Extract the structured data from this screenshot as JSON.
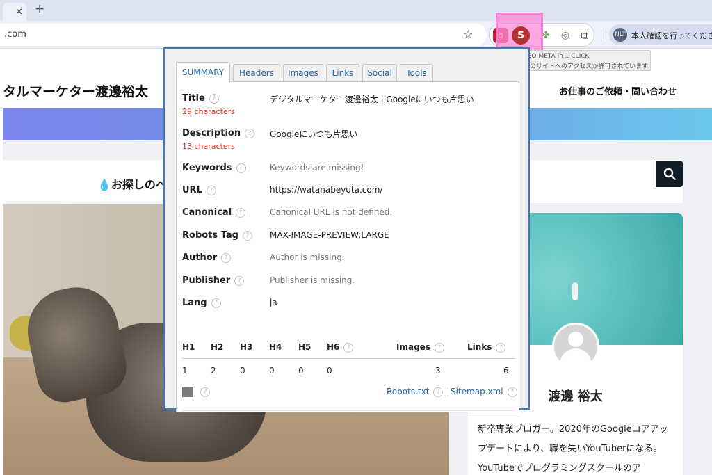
{
  "browser": {
    "tab_close": "✕",
    "new_tab": "+",
    "address": ".com",
    "star": "☆",
    "profile_avatar": "NLT",
    "profile_text": "本人確認を行ってくださ",
    "tooltip_title": "SEO META in 1 CLICK",
    "tooltip_text": "このサイトへのアクセスが許可されています",
    "extensions": {
      "red_label": "b",
      "seo_label": "S",
      "puzzle_colored": "✤",
      "camera": "◎",
      "puzzle": "⧉"
    }
  },
  "site": {
    "title": "タルマーケター渡邊裕太",
    "contact": "お仕事のご依頼・問い合わせ",
    "search_prefix": "💧",
    "search_label": "お探しのペ",
    "author_name": "渡邊 裕太",
    "author_bio": "新卒専業ブロガー。2020年のGoogleコアアップデートにより、職を失いYouTuberになる。YouTubeでプログラミングスクールのア"
  },
  "popup": {
    "tabs": [
      "SUMMARY",
      "Headers",
      "Images",
      "Links",
      "Social",
      "Tools"
    ],
    "active_tab": "SUMMARY",
    "help_glyph": "?",
    "rows": {
      "title": {
        "label": "Title",
        "count": "29 characters",
        "value": "デジタルマーケター渡邊裕太 | Googleにいつも片思い"
      },
      "description": {
        "label": "Description",
        "count": "13 characters",
        "value": "Googleにいつも片思い"
      },
      "keywords": {
        "label": "Keywords",
        "value": "Keywords are missing!"
      },
      "url": {
        "label": "URL",
        "value": "https://watanabeyuta.com/"
      },
      "canonical": {
        "label": "Canonical",
        "value": "Canonical URL is not defined."
      },
      "robots": {
        "label": "Robots Tag",
        "value": "MAX-IMAGE-PREVIEW:LARGE"
      },
      "author": {
        "label": "Author",
        "value": "Author is missing."
      },
      "publisher": {
        "label": "Publisher",
        "value": "Publisher is missing."
      },
      "lang": {
        "label": "Lang",
        "value": "ja"
      }
    },
    "headings": {
      "labels": {
        "h1": "H1",
        "h2": "H2",
        "h3": "H3",
        "h4": "H4",
        "h5": "H5",
        "h6": "H6",
        "images": "Images",
        "links": "Links"
      },
      "values": {
        "h1": "1",
        "h2": "2",
        "h3": "0",
        "h4": "0",
        "h5": "0",
        "h6": "0",
        "images": "3",
        "links": "6"
      }
    },
    "links": {
      "robots": "Robots.txt",
      "sitemap": "Sitemap.xml"
    }
  },
  "colors": {
    "accent_blue": "#2b68a5",
    "count_red": "#e0341f",
    "popup_border": "#4a74a8",
    "highlight_pink": "#ff8ad8"
  }
}
